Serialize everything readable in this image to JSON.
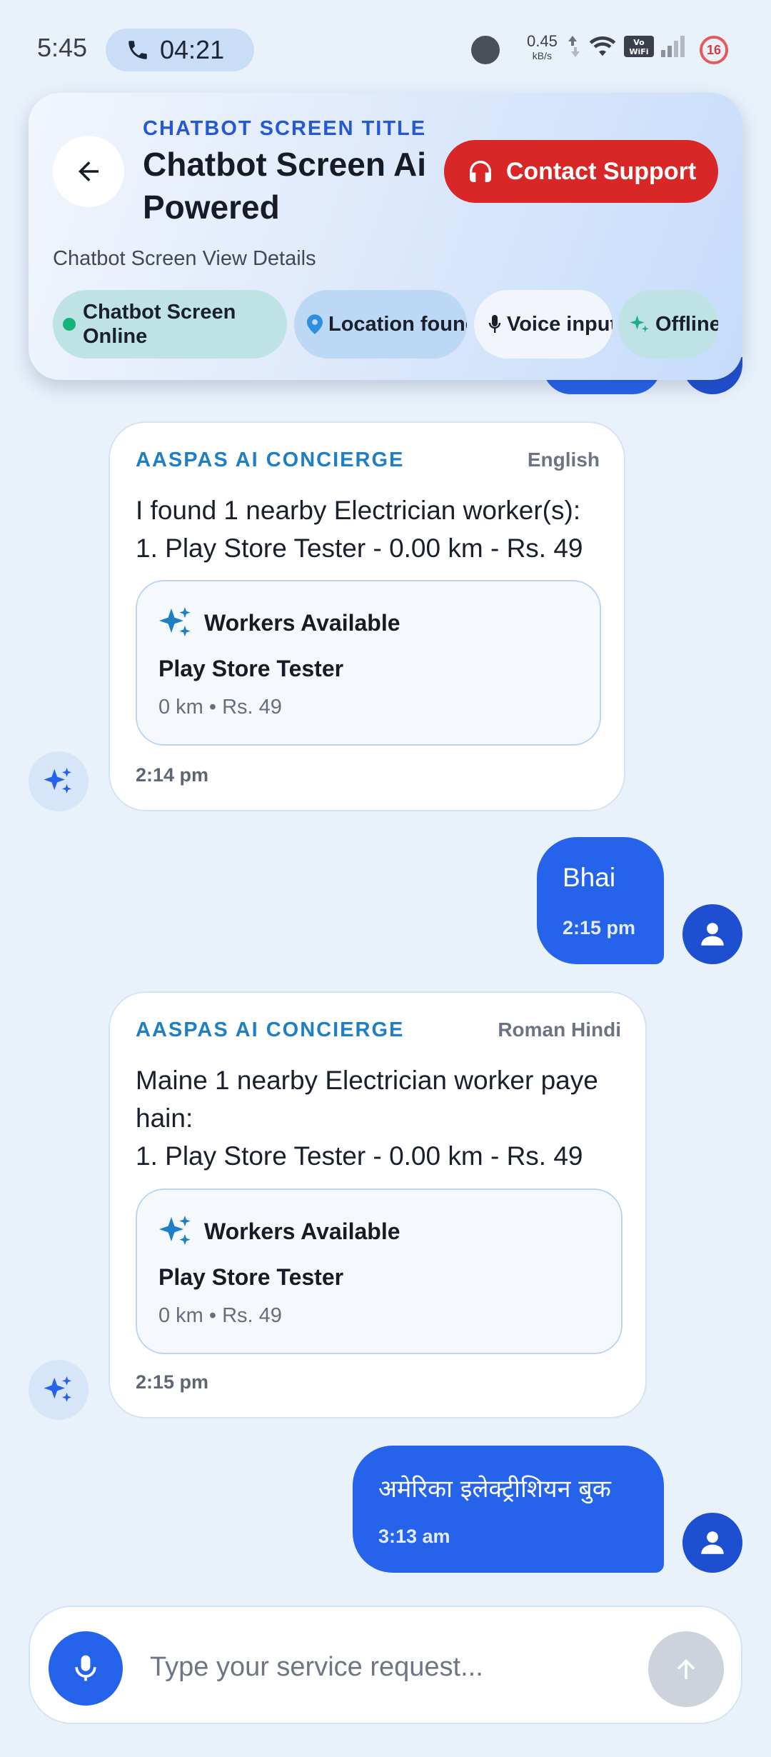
{
  "status_bar": {
    "time": "5:45",
    "call_timer": "04:21",
    "net_speed": "0.45",
    "net_unit": "kB/s",
    "battery": "16"
  },
  "header": {
    "eyebrow": "CHATBOT SCREEN TITLE",
    "title": "Chatbot Screen Ai Powered",
    "support_label": "Contact Support",
    "subtitle": "Chatbot Screen View Details",
    "chips": {
      "online": "Chatbot Screen Online",
      "location": "Location found",
      "voice": "Voice input",
      "offline": "Offline"
    }
  },
  "messages": [
    {
      "sender": "ai",
      "label": "AASPAS AI CONCIERGE",
      "language": "English",
      "text": "I found 1 nearby Electrician worker(s):\n1. Play Store Tester - 0.00 km - Rs. 49",
      "card": {
        "title": "Workers Available",
        "worker": "Play Store Tester",
        "meta": "0 km • Rs. 49"
      },
      "time": "2:14 pm"
    },
    {
      "sender": "user",
      "text": "Bhai",
      "time": "2:15 pm"
    },
    {
      "sender": "ai",
      "label": "AASPAS AI CONCIERGE",
      "language": "Roman Hindi",
      "text": "Maine 1 nearby Electrician worker paye\nhain:\n1. Play Store Tester - 0.00 km - Rs. 49",
      "card": {
        "title": "Workers Available",
        "worker": "Play Store Tester",
        "meta": "0 km • Rs. 49"
      },
      "time": "2:15 pm"
    },
    {
      "sender": "user",
      "text": "अमेरिका इलेक्ट्रीशियन बुक",
      "time": "3:13 am"
    }
  ],
  "composer": {
    "value": "",
    "placeholder": "Type your service request..."
  },
  "colors": {
    "accent": "#2563eb",
    "support": "#d92626",
    "online": "#14b37a",
    "ai_label": "#1f7fc6"
  }
}
